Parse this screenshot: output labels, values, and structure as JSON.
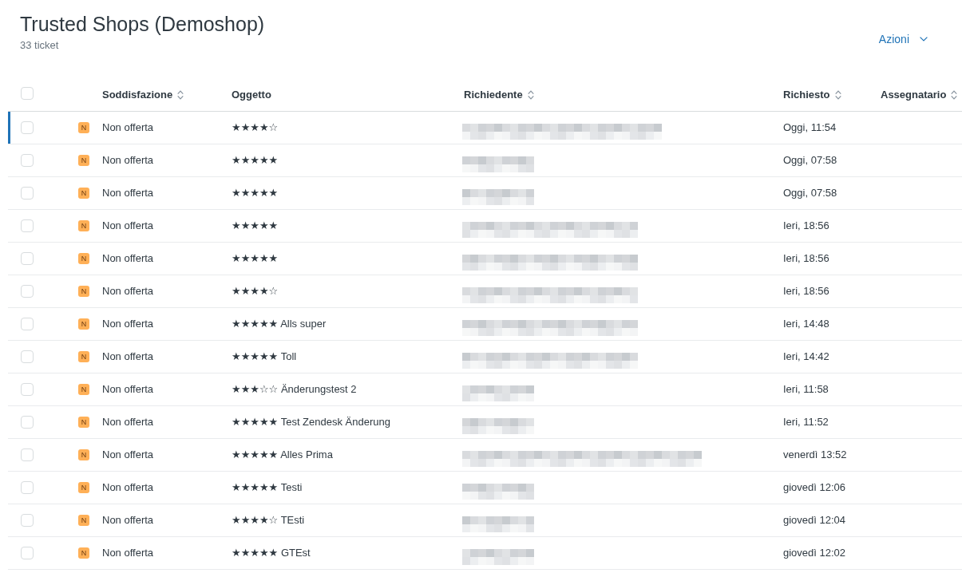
{
  "header": {
    "title": "Trusted Shops (Demoshop)",
    "count": "33 ticket",
    "actions": "Azioni"
  },
  "table": {
    "select_all": {
      "checked": false
    },
    "columns": [
      {
        "label": "Soddisfazione",
        "sortable": true
      },
      {
        "label": "Oggetto",
        "sortable": false
      },
      {
        "label": "Richiedente",
        "sortable": true
      },
      {
        "label": "Richiesto",
        "sortable": true
      },
      {
        "label": "Assegnatario",
        "sortable": true
      }
    ],
    "rows": [
      {
        "selected": true,
        "checked": false,
        "badge": "N",
        "satisfaction": "Non offerta",
        "subject": "★★★★☆",
        "requester": {
          "kind": "pixelated_long"
        },
        "requested": "Oggi, 11:54"
      },
      {
        "selected": false,
        "checked": false,
        "badge": "N",
        "satisfaction": "Non offerta",
        "subject": "★★★★★",
        "requester": {
          "kind": "pixelated_short"
        },
        "requested": "Oggi, 07:58"
      },
      {
        "selected": false,
        "checked": false,
        "badge": "N",
        "satisfaction": "Non offerta",
        "subject": "★★★★★",
        "requester": {
          "kind": "pixelated_short"
        },
        "requested": "Oggi, 07:58"
      },
      {
        "selected": false,
        "checked": false,
        "badge": "N",
        "satisfaction": "Non offerta",
        "subject": "★★★★★",
        "requester": {
          "kind": "pixelated_medium"
        },
        "requested": "Ieri, 18:56"
      },
      {
        "selected": false,
        "checked": false,
        "badge": "N",
        "satisfaction": "Non offerta",
        "subject": "★★★★★",
        "requester": {
          "kind": "pixelated_medium"
        },
        "requested": "Ieri, 18:56"
      },
      {
        "selected": false,
        "checked": false,
        "badge": "N",
        "satisfaction": "Non offerta",
        "subject": "★★★★☆",
        "requester": {
          "kind": "pixelated_medium"
        },
        "requested": "Ieri, 18:56"
      },
      {
        "selected": false,
        "checked": false,
        "badge": "N",
        "satisfaction": "Non offerta",
        "subject": "★★★★★ Alls super",
        "requester": {
          "kind": "pixelated_medium"
        },
        "requested": "Ieri, 14:48"
      },
      {
        "selected": false,
        "checked": false,
        "badge": "N",
        "satisfaction": "Non offerta",
        "subject": "★★★★★ Toll",
        "requester": {
          "kind": "pixelated_medium"
        },
        "requested": "Ieri, 14:42"
      },
      {
        "selected": false,
        "checked": false,
        "badge": "N",
        "satisfaction": "Non offerta",
        "subject": "★★★☆☆ Änderungstest 2",
        "requester": {
          "kind": "pixelated_short"
        },
        "requested": "Ieri, 11:58"
      },
      {
        "selected": false,
        "checked": false,
        "badge": "N",
        "satisfaction": "Non offerta",
        "subject": "★★★★★ Test Zendesk Änderung",
        "requester": {
          "kind": "pixelated_short"
        },
        "requested": "Ieri, 11:52"
      },
      {
        "selected": false,
        "checked": false,
        "badge": "N",
        "satisfaction": "Non offerta",
        "subject": "★★★★★ Alles Prima",
        "requester": {
          "kind": "pixelated_longest"
        },
        "requested": "venerdì 13:52"
      },
      {
        "selected": false,
        "checked": false,
        "badge": "N",
        "satisfaction": "Non offerta",
        "subject": "★★★★★ Testi",
        "requester": {
          "kind": "pixelated_short"
        },
        "requested": "giovedì 12:06"
      },
      {
        "selected": false,
        "checked": false,
        "badge": "N",
        "satisfaction": "Non offerta",
        "subject": "★★★★☆ TEsti",
        "requester": {
          "kind": "pixelated_short"
        },
        "requested": "giovedì 12:04"
      },
      {
        "selected": false,
        "checked": false,
        "badge": "N",
        "satisfaction": "Non offerta",
        "subject": "★★★★★ GTEst",
        "requester": {
          "kind": "pixelated_short"
        },
        "requested": "giovedì 12:02"
      }
    ]
  }
}
